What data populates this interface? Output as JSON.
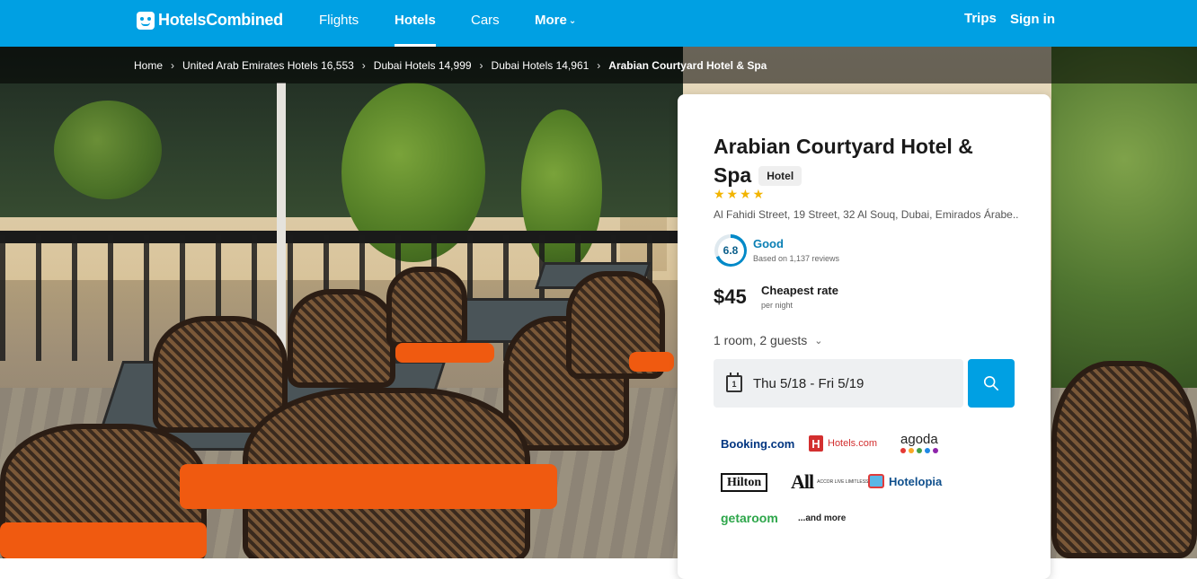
{
  "header": {
    "logo_text": "HotelsCombined",
    "nav": [
      {
        "label": "Flights"
      },
      {
        "label": "Hotels"
      },
      {
        "label": "Cars"
      },
      {
        "label": "More"
      }
    ],
    "trips_label": "Trips",
    "signin_label": "Sign in",
    "active_nav": "Hotels"
  },
  "breadcrumb": [
    {
      "label": "Home"
    },
    {
      "label": "United Arab Emirates Hotels 16,553"
    },
    {
      "label": "Dubai Hotels 14,999"
    },
    {
      "label": "Dubai Hotels 14,961"
    },
    {
      "label": "Arabian Courtyard Hotel & Spa"
    }
  ],
  "hotel": {
    "name": "Arabian Courtyard Hotel & Spa",
    "type_badge": "Hotel",
    "stars": "★★★★",
    "star_count": 4,
    "address": "Al Fahidi Street, 19 Street, 32 Al Souq, Dubai, Emirados Árabe...",
    "rating_score": "6.8",
    "rating_label": "Good",
    "rating_reviews": "Based on 1,137 reviews",
    "price": "$45",
    "price_label": "Cheapest rate",
    "price_sub": "per night",
    "guests": "1 room, 2 guests",
    "calendar_day": "1",
    "dates": "Thu 5/18  -  Fri 5/19"
  },
  "providers": {
    "booking": "Booking.com",
    "hotels_com": "Hotels.com",
    "hotels_mark": "H",
    "agoda": "agoda",
    "hilton": "Hilton",
    "all_big": "All",
    "all_small": "ACCOR LIVE LIMITLESS",
    "hotelopia": "Hotelopia",
    "getaroom": "getaroom",
    "more": "...and more"
  },
  "colors": {
    "brand": "#00a0e3",
    "star": "#f2b400",
    "rating": "#0a7fb4",
    "agoda_dots": [
      "#e53935",
      "#f9a825",
      "#43a047",
      "#1e88e5",
      "#8e24aa"
    ]
  },
  "icons": {
    "search": "search-icon",
    "calendar": "calendar-icon",
    "chevron": "chevron-down-icon",
    "breadcrumb_sep": "chevron-right-icon"
  }
}
